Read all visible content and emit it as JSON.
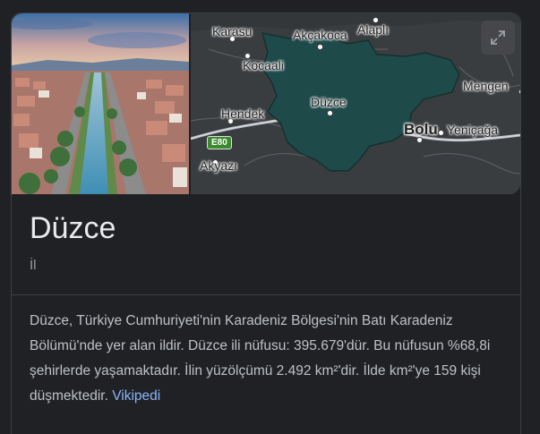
{
  "map": {
    "places": {
      "karasu": "Karasu",
      "akcakoca": "Akçakoca",
      "alapli": "Alaplı",
      "kocaali": "Kocaali",
      "mengen": "Mengen",
      "duzce": "Düzce",
      "hendek": "Hendek",
      "bolu": "Bolu",
      "yenicaga": "Yeniçağa",
      "akyazi": "Akyazı"
    },
    "road_shield": "E80",
    "expand_icon": "expand-icon"
  },
  "entity": {
    "title": "Düzce",
    "subtitle": "İl",
    "description": "Düzce, Türkiye Cumhuriyeti'nin Karadeniz Bölgesi'nin Batı Karadeniz Bölümü'nde yer alan ildir. Düzce ili nüfusu: 395.679'dür. Bu nüfusun %68,8i şehirlerde yaşamaktadır. İlin yüzölçümü 2.492 km²'dir. İlde km²'ye 159 kişi düşmektedir.",
    "source_link": "Vikipedi"
  },
  "colors": {
    "background": "#202124",
    "province_fill": "#1f4a4a",
    "link": "#8ab4f8"
  }
}
